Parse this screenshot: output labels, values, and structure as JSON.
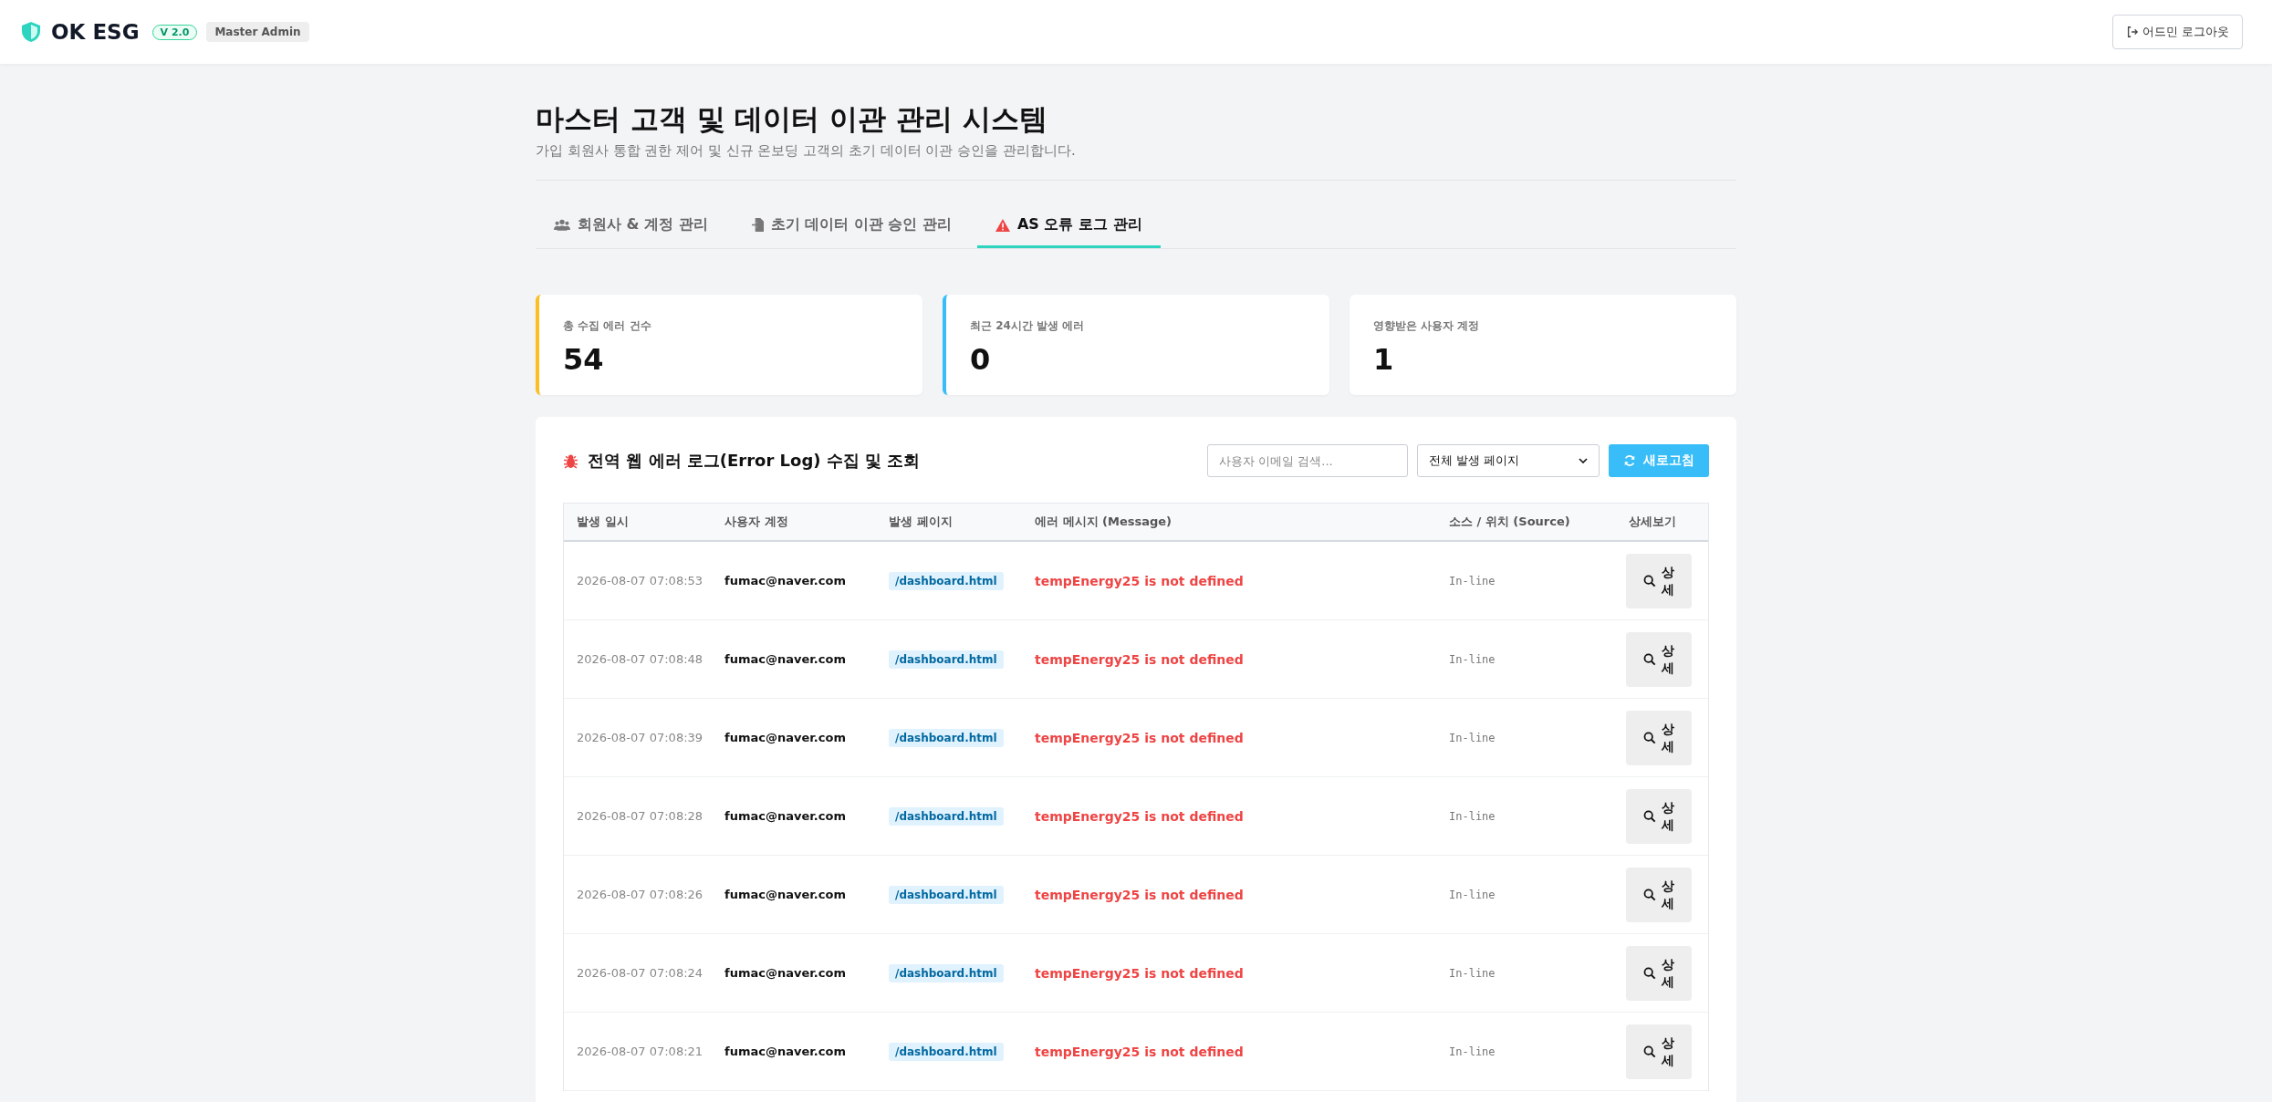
{
  "header": {
    "brand": "OK ESG",
    "version": "V 2.0",
    "role": "Master Admin",
    "logout": "어드민 로그아웃"
  },
  "page": {
    "title": "마스터 고객 및 데이터 이관 관리 시스템",
    "subtitle": "가입 회원사 통합 권한 제어 및 신규 온보딩 고객의 초기 데이터 이관 승인을 관리합니다."
  },
  "tabs": [
    {
      "label": "회원사 & 계정 관리",
      "kind": "members",
      "selected": false
    },
    {
      "label": "초기 데이터 이관 승인 관리",
      "kind": "migration",
      "selected": false
    },
    {
      "label": "AS 오류 로그 관리",
      "kind": "errors",
      "selected": true
    }
  ],
  "stats": [
    {
      "label": "총 수집 에러 건수",
      "value": "54",
      "color": "#fbbf24"
    },
    {
      "label": "최근 24시간 발생 에러",
      "value": "0",
      "color": "#38bdf8"
    },
    {
      "label": "영향받은 사용자 계정",
      "value": "1"
    }
  ],
  "log_panel": {
    "title": "전역 웹 에러 로그(Error Log) 수집 및 조회",
    "search": {
      "placeholder": "사용자 이메일 검색..."
    },
    "page_filter": "전체 발생 페이지",
    "refresh": "새로고침"
  },
  "table": {
    "columns": [
      "발생 일시",
      "사용자 계정",
      "발생 페이지",
      "에러 메시지 (Message)",
      "소스 / 위치 (Source)",
      "상세보기"
    ],
    "rows": [
      {
        "time": "2026-08-07 07:08:53",
        "user": "fumac@naver.com",
        "page": "/dashboard.html",
        "message": "tempEnergy25 is not defined",
        "source": "In-line",
        "action": "상세"
      },
      {
        "time": "2026-08-07 07:08:48",
        "user": "fumac@naver.com",
        "page": "/dashboard.html",
        "message": "tempEnergy25 is not defined",
        "source": "In-line",
        "action": "상세"
      },
      {
        "time": "2026-08-07 07:08:39",
        "user": "fumac@naver.com",
        "page": "/dashboard.html",
        "message": "tempEnergy25 is not defined",
        "source": "In-line",
        "action": "상세"
      },
      {
        "time": "2026-08-07 07:08:28",
        "user": "fumac@naver.com",
        "page": "/dashboard.html",
        "message": "tempEnergy25 is not defined",
        "source": "In-line",
        "action": "상세"
      },
      {
        "time": "2026-08-07 07:08:26",
        "user": "fumac@naver.com",
        "page": "/dashboard.html",
        "message": "tempEnergy25 is not defined",
        "source": "In-line",
        "action": "상세"
      },
      {
        "time": "2026-08-07 07:08:24",
        "user": "fumac@naver.com",
        "page": "/dashboard.html",
        "message": "tempEnergy25 is not defined",
        "source": "In-line",
        "action": "상세"
      },
      {
        "time": "2026-08-07 07:08:21",
        "user": "fumac@naver.com",
        "page": "/dashboard.html",
        "message": "tempEnergy25 is not defined",
        "source": "In-line",
        "action": "상세"
      }
    ]
  }
}
